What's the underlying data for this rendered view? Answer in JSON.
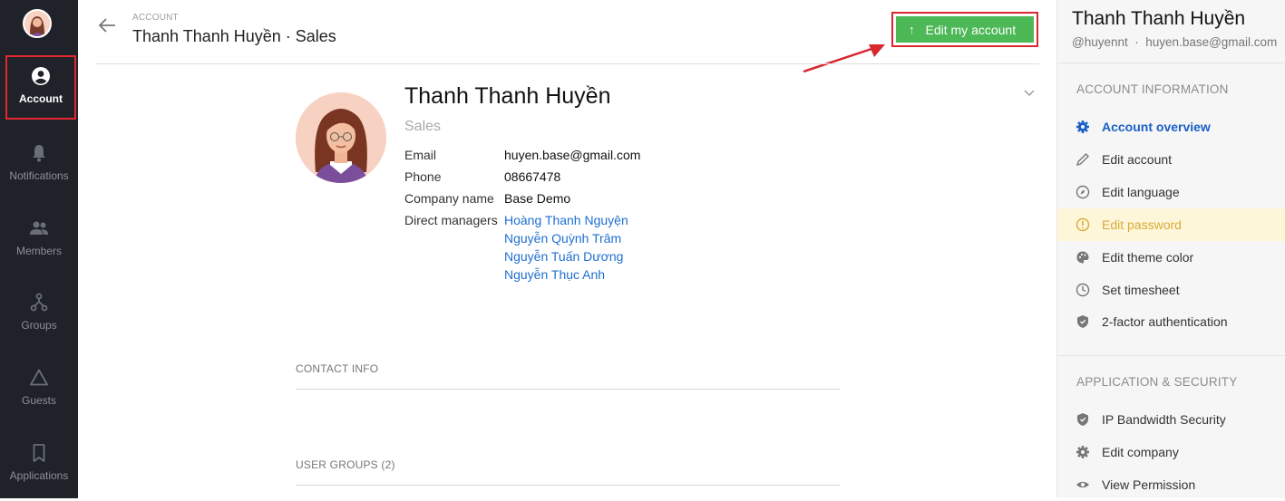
{
  "nav": {
    "items": [
      {
        "label": "Account"
      },
      {
        "label": "Notifications"
      },
      {
        "label": "Members"
      },
      {
        "label": "Groups"
      },
      {
        "label": "Guests"
      },
      {
        "label": "Applications"
      }
    ]
  },
  "header": {
    "crumb": "ACCOUNT",
    "title": "Thanh Thanh Huyền · Sales",
    "edit_button": "Edit my account"
  },
  "profile": {
    "name": "Thanh Thanh Huyền",
    "role": "Sales",
    "fields": [
      {
        "label": "Email",
        "value": "huyen.base@gmail.com"
      },
      {
        "label": "Phone",
        "value": "08667478"
      },
      {
        "label": "Company name",
        "value": "Base Demo"
      },
      {
        "label": "Direct managers",
        "value": ""
      }
    ],
    "managers": [
      "Hoàng Thanh Nguyện",
      "Nguyễn Quỳnh Trâm",
      "Nguyễn Tuấn Dương",
      "Nguyễn Thục Anh"
    ]
  },
  "sections": {
    "contact": "CONTACT INFO",
    "groups": "USER GROUPS (2)"
  },
  "right_panel": {
    "name": "Thanh Thanh Huyền",
    "username": "@huyennt",
    "email": "huyen.base@gmail.com",
    "account_section": "ACCOUNT INFORMATION",
    "account_items": [
      {
        "label": "Account overview",
        "icon": "gear-icon"
      },
      {
        "label": "Edit account",
        "icon": "pencil-icon"
      },
      {
        "label": "Edit language",
        "icon": "compass-icon"
      },
      {
        "label": "Edit password",
        "icon": "alert-icon"
      },
      {
        "label": "Edit theme color",
        "icon": "palette-icon"
      },
      {
        "label": "Set timesheet",
        "icon": "clock-icon"
      },
      {
        "label": "2-factor authentication",
        "icon": "shield-icon"
      }
    ],
    "app_section": "APPLICATION & SECURITY",
    "app_items": [
      {
        "label": "IP Bandwidth Security",
        "icon": "shield-icon"
      },
      {
        "label": "Edit company",
        "icon": "gear-icon"
      },
      {
        "label": "View Permission",
        "icon": "eye-icon"
      }
    ]
  },
  "colors": {
    "sidebar_bg": "#1f2329",
    "button_green": "#4cb856",
    "highlight_red": "#d9272e",
    "link_blue": "#1e6fd1",
    "warn_bg": "#fdf6d8"
  }
}
